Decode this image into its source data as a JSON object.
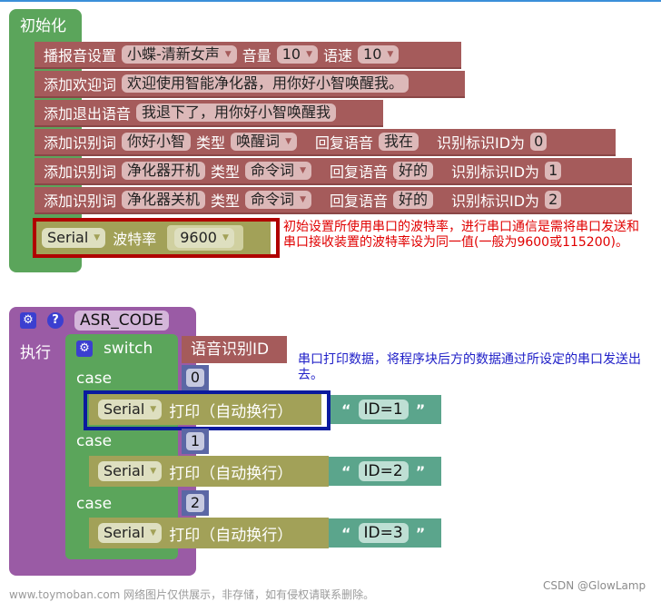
{
  "init_block": {
    "title": "初始化",
    "rows": [
      {
        "label": "播报音设置",
        "voice": "小蝶-清新女声",
        "volume_label": "音量",
        "volume": "10",
        "speed_label": "语速",
        "speed": "10"
      },
      {
        "label": "添加欢迎词",
        "text": "欢迎使用智能净化器，用你好小智唤醒我。"
      },
      {
        "label": "添加退出语音",
        "text": "我退下了，用你好小智唤醒我"
      },
      {
        "label": "添加识别词",
        "word": "你好小智",
        "type_label": "类型",
        "type": "唤醒词",
        "reply_label": "回复语音",
        "reply": "我在",
        "id_label": "识别标识ID为",
        "id": "0"
      },
      {
        "label": "添加识别词",
        "word": "净化器开机",
        "type_label": "类型",
        "type": "命令词",
        "reply_label": "回复语音",
        "reply": "好的",
        "id_label": "识别标识ID为",
        "id": "1"
      },
      {
        "label": "添加识别词",
        "word": "净化器关机",
        "type_label": "类型",
        "type": "命令词",
        "reply_label": "回复语音",
        "reply": "好的",
        "id_label": "识别标识ID为",
        "id": "2"
      }
    ],
    "baud": {
      "port": "Serial",
      "label": "波特率",
      "value": "9600"
    }
  },
  "notes": {
    "red": "初始设置所使用串口的波特率，进行串口通信是需将串口发送和串口接收装置的波特率设为同一值(一般为9600或115200)。",
    "blue": "串口打印数据，将程序块后方的数据通过所设定的串口发送出去。"
  },
  "proc_block": {
    "name": "ASR_CODE",
    "exec_label": "执行",
    "switch_label": "switch",
    "switch_input": "语音识别ID",
    "case_label": "case",
    "cases": [
      {
        "value": "0",
        "port": "Serial",
        "action": "打印（自动换行）",
        "string": "ID=1"
      },
      {
        "value": "1",
        "port": "Serial",
        "action": "打印（自动换行）",
        "string": "ID=2"
      },
      {
        "value": "2",
        "port": "Serial",
        "action": "打印（自动换行）",
        "string": "ID=3"
      }
    ]
  },
  "icons": {
    "gear": "⚙",
    "help": "?",
    "dropdown": "▼",
    "quote_open": "“",
    "quote_close": "”"
  },
  "footer": {
    "watermark": "www.toymoban.com 网络图片仅供展示，非存储，如有侵权请联系删除。",
    "credit": "CSDN @GlowLamp"
  },
  "colors": {
    "init_green": "#5ba55b",
    "asr_red": "#a55b5b",
    "serial_olive": "#a2a158",
    "proc_purple": "#9a5ba5",
    "math_blue": "#5b67a5",
    "text_teal": "#5ba58c",
    "highlight_red": "#b00000",
    "highlight_blue": "#0a1a9e"
  }
}
